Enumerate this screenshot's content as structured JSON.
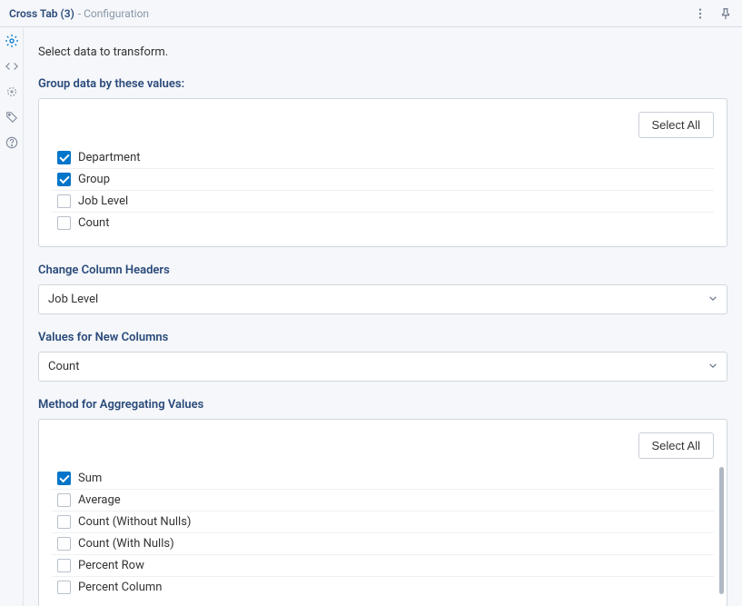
{
  "header": {
    "title": "Cross Tab (3)",
    "subtitle": "- Configuration"
  },
  "intro": "Select data to transform.",
  "groupSection": {
    "label": "Group data by these values:",
    "selectAll": "Select All",
    "items": [
      {
        "label": "Department",
        "checked": true
      },
      {
        "label": "Group",
        "checked": true
      },
      {
        "label": "Job Level",
        "checked": false
      },
      {
        "label": "Count",
        "checked": false
      }
    ]
  },
  "changeHeaders": {
    "label": "Change Column Headers",
    "value": "Job Level"
  },
  "valuesNew": {
    "label": "Values for New Columns",
    "value": "Count"
  },
  "aggSection": {
    "label": "Method for Aggregating Values",
    "selectAll": "Select All",
    "items": [
      {
        "label": "Sum",
        "checked": true
      },
      {
        "label": "Average",
        "checked": false
      },
      {
        "label": "Count (Without Nulls)",
        "checked": false
      },
      {
        "label": "Count (With Nulls)",
        "checked": false
      },
      {
        "label": "Percent Row",
        "checked": false
      },
      {
        "label": "Percent Column",
        "checked": false
      }
    ]
  }
}
